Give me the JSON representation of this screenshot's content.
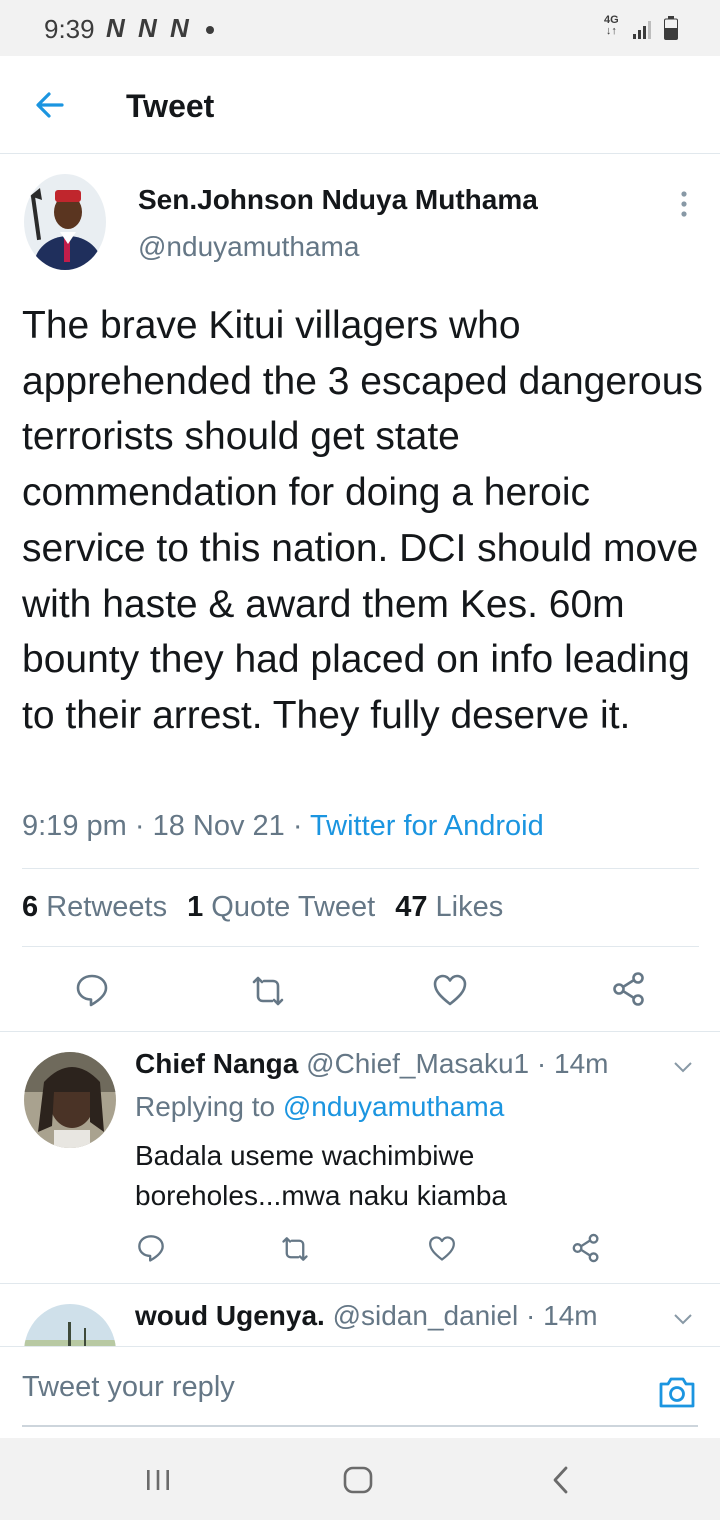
{
  "status_bar": {
    "time": "9:39",
    "notification_icons": [
      "N",
      "N",
      "N"
    ],
    "network": "4G"
  },
  "header": {
    "title": "Tweet"
  },
  "tweet": {
    "author_name": "Sen.Johnson Nduya Muthama",
    "author_handle": "@nduyamuthama",
    "text": "The brave Kitui villagers who apprehended the 3 escaped dangerous terrorists should get state commendation for doing a heroic service to this nation. DCI should move with haste & award them Kes. 60m bounty they had placed on info leading to their arrest. They fully deserve it.",
    "time": "9:19 pm",
    "date": "18 Nov 21",
    "separator": " · ",
    "source": "Twitter for Android",
    "stats": {
      "retweets_count": "6",
      "retweets_label": "Retweets",
      "quotes_count": "1",
      "quotes_label": "Quote Tweet",
      "likes_count": "47",
      "likes_label": "Likes"
    }
  },
  "replies": [
    {
      "name": "Chief Nanga",
      "handle": "@Chief_Masaku1",
      "time": "14m",
      "replying_label": "Replying to",
      "replying_to": "@nduyamuthama",
      "text": "Badala useme wachimbiwe boreholes...mwa naku kiamba"
    },
    {
      "name": "woud Ugenya.",
      "handle": "@sidan_daniel",
      "time": "14m"
    }
  ],
  "compose": {
    "placeholder": "Tweet your reply"
  },
  "icons": {
    "back": "arrow-left-icon",
    "more": "more-vertical-icon",
    "reply": "comment-icon",
    "retweet": "retweet-icon",
    "like": "heart-icon",
    "share": "share-icon",
    "camera": "camera-icon",
    "recent_apps": "recent-apps-icon",
    "home": "home-icon",
    "nav_back": "chevron-left-icon"
  },
  "colors": {
    "accent": "#1b95e0",
    "text_primary": "#14171a",
    "text_secondary": "#657786",
    "divider": "#e1e8ed"
  }
}
